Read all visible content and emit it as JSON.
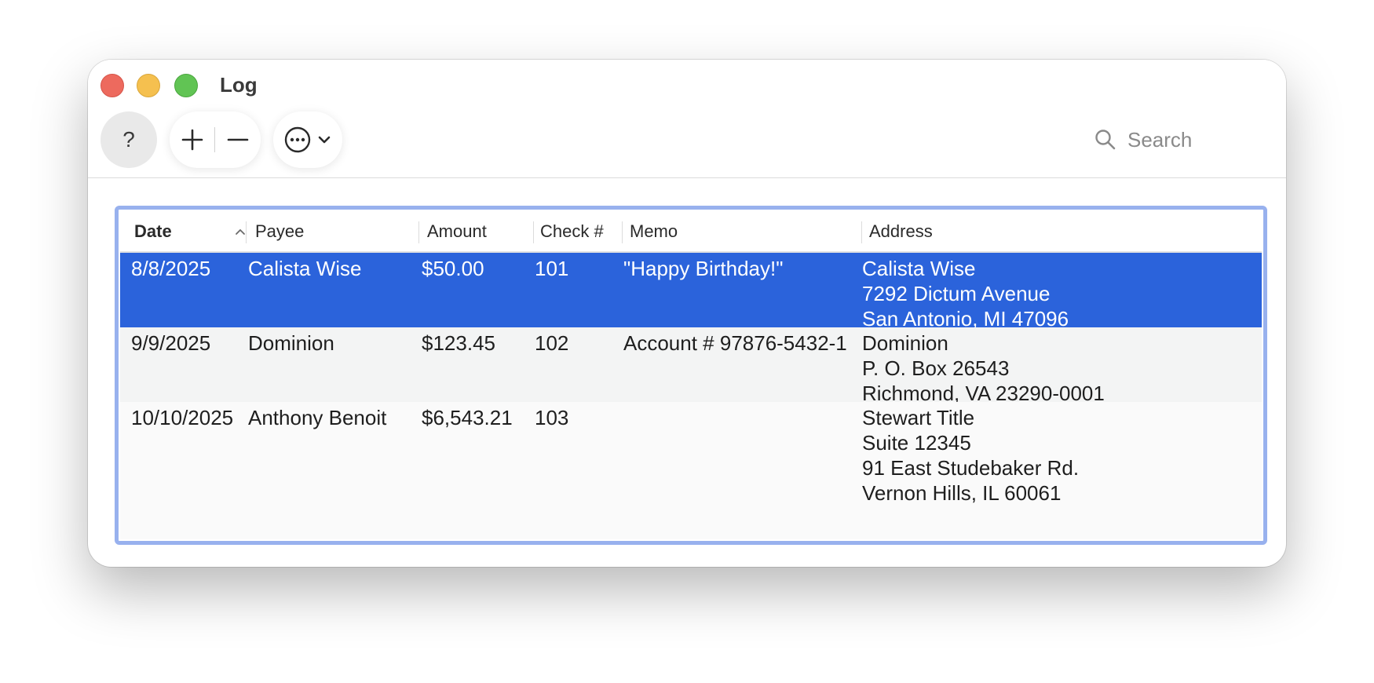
{
  "window": {
    "title": "Log"
  },
  "toolbar": {
    "help_label": "?",
    "search_placeholder": "Search"
  },
  "icons": {
    "add": "plus-icon",
    "remove": "minus-icon",
    "more": "ellipsis-circle-icon",
    "dropdown": "chevron-down-icon",
    "search": "magnifier-icon",
    "sort": "chevron-up-icon"
  },
  "colors": {
    "selection": "#2b63db",
    "focus_ring": "#98b1ee",
    "close": "#ed6a5e",
    "minimize": "#f5c04f",
    "zoom": "#61c454"
  },
  "table": {
    "columns": [
      "Date",
      "Payee",
      "Amount",
      "Check #",
      "Memo",
      "Address"
    ],
    "sorted_column": "Date",
    "sort_direction": "ascending",
    "rows": [
      {
        "date": "8/8/2025",
        "payee": "Calista Wise",
        "amount": "$50.00",
        "check": "101",
        "memo": "\"Happy Birthday!\"",
        "address": [
          "Calista Wise",
          "7292 Dictum Avenue",
          "San Antonio, MI 47096"
        ],
        "selected": true
      },
      {
        "date": "9/9/2025",
        "payee": "Dominion",
        "amount": "$123.45",
        "check": "102",
        "memo": "Account # 97876-5432-1",
        "address": [
          "Dominion",
          "P. O. Box 26543",
          "Richmond, VA 23290-0001"
        ],
        "selected": false
      },
      {
        "date": "10/10/2025",
        "payee": "Anthony Benoit",
        "amount": "$6,543.21",
        "check": "103",
        "memo": "",
        "address": [
          "Stewart Title",
          "Suite 12345",
          "91 East Studebaker Rd.",
          "Vernon Hills, IL 60061"
        ],
        "selected": false
      }
    ]
  }
}
